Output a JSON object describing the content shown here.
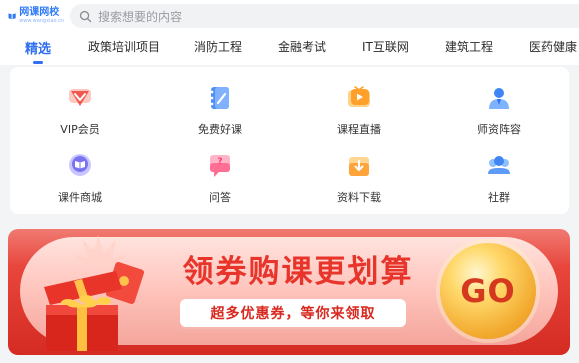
{
  "header": {
    "logo_text": "网课网校",
    "logo_sub": "www.wangxiao.cn",
    "search_placeholder": "搜索想要的内容"
  },
  "tabs": [
    {
      "label": "精选",
      "active": true
    },
    {
      "label": "政策培训项目"
    },
    {
      "label": "消防工程"
    },
    {
      "label": "金融考试"
    },
    {
      "label": "IT互联网"
    },
    {
      "label": "建筑工程"
    },
    {
      "label": "医药健康"
    }
  ],
  "grid": [
    {
      "label": "VIP会员",
      "icon": "vip-icon"
    },
    {
      "label": "免费好课",
      "icon": "notebook-icon"
    },
    {
      "label": "课程直播",
      "icon": "live-play-icon"
    },
    {
      "label": "师资阵容",
      "icon": "teacher-icon"
    },
    {
      "label": "课件商城",
      "icon": "book-store-icon"
    },
    {
      "label": "问答",
      "icon": "question-icon"
    },
    {
      "label": "资料下载",
      "icon": "download-icon"
    },
    {
      "label": "社群",
      "icon": "community-icon"
    }
  ],
  "banner": {
    "title": "领券购课更划算",
    "subtitle": "超多优惠券，等你来领取",
    "go_label": "GO"
  },
  "colors": {
    "accent": "#2f6ff0",
    "banner_red": "#e8463c"
  }
}
